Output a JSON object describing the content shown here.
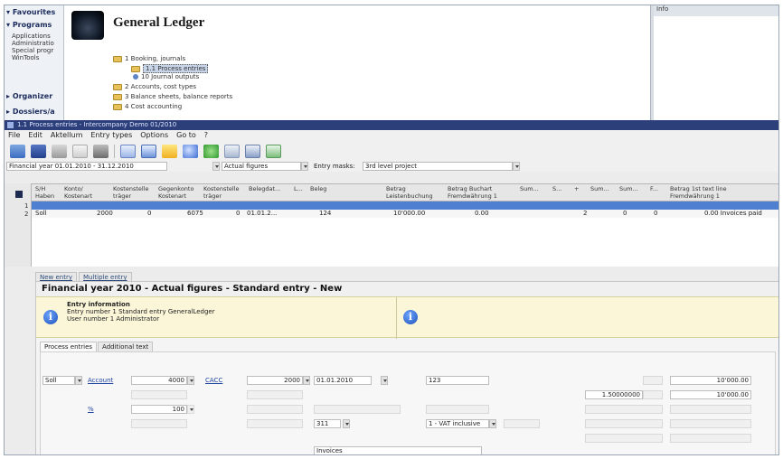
{
  "nav": {
    "favourites": "Favourites",
    "programs": "Programs",
    "program_items": [
      "Applications",
      "Administratio",
      "Special progr",
      "WinTools"
    ],
    "organizer": "Organizer",
    "dossiers": "Dossiers/a"
  },
  "module": {
    "title": "General Ledger",
    "tree": [
      "1 Booking, journals",
      "1.1 Process entries",
      "10 Journal outputs",
      "2 Accounts, cost types",
      "3 Balance sheets, balance reports",
      "4 Cost accounting"
    ]
  },
  "right_panel": {
    "header": "Info"
  },
  "app": {
    "title": "1.1 Process entries - Intercompany Demo 01/2010",
    "menu": [
      "File",
      "Edit",
      "Aktellum",
      "Entry types",
      "Options",
      "Go to",
      "?"
    ],
    "filters": {
      "period": "Financial year 01.01.2010 - 31.12.2010",
      "figures": "Actual figures",
      "entry_mask_label": "Entry masks:",
      "entry_mask_value": "3rd level project"
    },
    "grid": {
      "headers": [
        "S/H\nHaben",
        "Konto/\nKostenart",
        "Kostenstelle\nträger",
        "Gegenkonto\nKostenart",
        "Kostenstelle\nträger",
        "Belegdat...",
        "L...",
        "Beleg",
        "Betrag\nLeistenbuchung",
        "Betrag Buchart\nFremdwährung 1",
        "Sum...",
        "S...",
        "+",
        "Sum...",
        "Sum...",
        "F...",
        "Betrag 1st text line\nFremdwährung 1"
      ],
      "rows": [
        [
          "Soll",
          "2000",
          "0",
          "6075",
          "0",
          "01.01.2...",
          "",
          "124",
          "10'000.00",
          "0.00",
          "",
          "",
          "2",
          "",
          "0",
          "0",
          "0.00 Invoices paid"
        ]
      ]
    },
    "tabs": [
      "New entry",
      "Multiple entry"
    ]
  },
  "entry": {
    "title": "Financial year 2010 - Actual figures - Standard entry - New",
    "info_heading": "Entry information",
    "info_lines": [
      "Entry number 1 Standard entry GeneralLedger",
      "User number 1 Administrator"
    ],
    "subtabs": [
      "Process entries",
      "Additional text"
    ],
    "form": {
      "debit_credit": "Soll",
      "account_label": "Account",
      "account_value": "4000",
      "contra_label": "CACC",
      "contra_value": "2000",
      "date_value": "01.01.2010",
      "doc_value": "123",
      "amount_1": "10'000.00",
      "rate": "1.50000000",
      "amount_2": "10'000.00",
      "percent_label": "%",
      "percent_value": "100",
      "vat_code": "311",
      "vat_text": "1 - VAT inclusive",
      "text_value": "Invoices"
    }
  }
}
